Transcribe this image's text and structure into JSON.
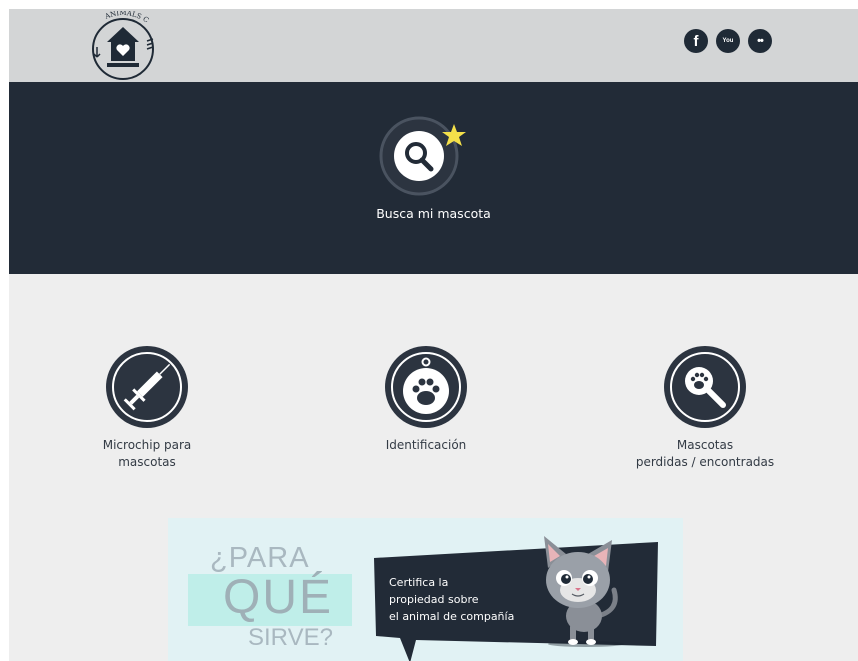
{
  "header": {
    "logo_text": "ANIMALS CARES",
    "social": [
      {
        "name": "facebook",
        "glyph": "f"
      },
      {
        "name": "youtube",
        "glyph": "You"
      },
      {
        "name": "flickr",
        "glyph": "••"
      }
    ]
  },
  "hero": {
    "label": "Busca mi mascota",
    "icon": "search-star-icon"
  },
  "services": [
    {
      "line1": "Microchip para",
      "line2": "mascotas",
      "icon": "syringe-icon"
    },
    {
      "line1": "Identificación",
      "line2": "",
      "icon": "paw-tag-icon"
    },
    {
      "line1": "Mascotas",
      "line2": "perdidas / encontradas",
      "icon": "paw-search-icon"
    }
  ],
  "banner": {
    "para": "¿PARA",
    "que": "QUÉ",
    "sirve": "SIRVE?",
    "text_line1": "Certifica la",
    "text_line2": "propiedad sobre",
    "text_line3": "el animal de compañía"
  },
  "colors": {
    "header_bg": "#d3d5d6",
    "hero_bg": "#222b37",
    "content_bg": "#eeeeee",
    "icon_dark": "#2c3440",
    "star": "#f4e04a",
    "banner_bg": "#e1f2f4"
  }
}
